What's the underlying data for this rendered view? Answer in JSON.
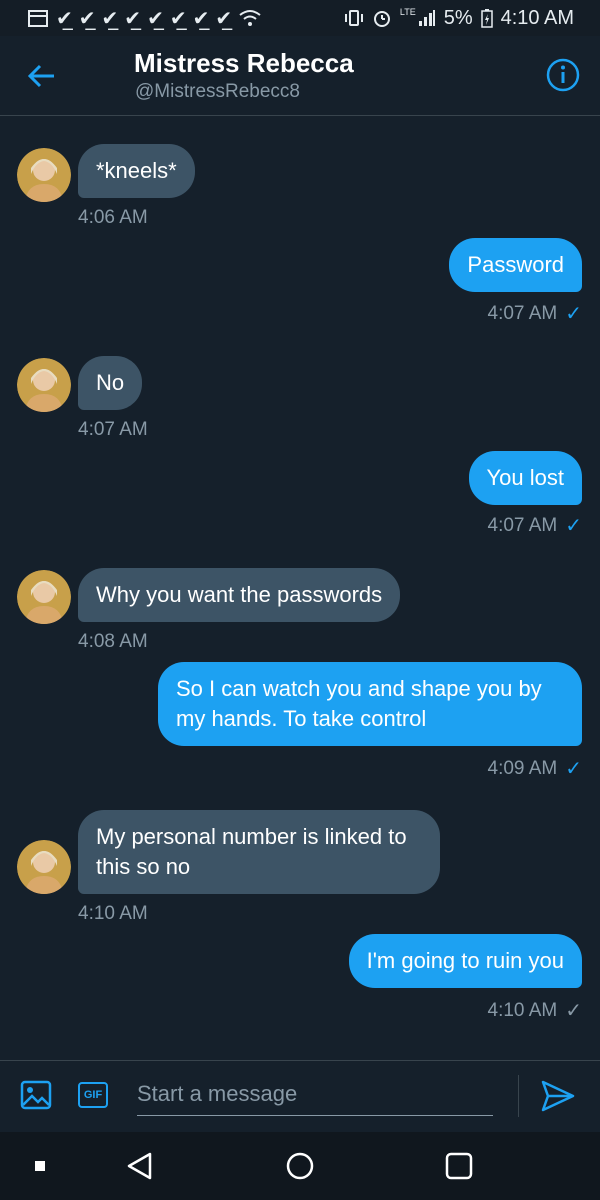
{
  "status": {
    "battery": "5%",
    "time": "4:10 AM",
    "network": "LTE"
  },
  "header": {
    "name": "Mistress Rebecca",
    "handle": "@MistressRebecc8"
  },
  "messages": [
    {
      "from": "them",
      "text": "*kneels*",
      "time": "4:06 AM"
    },
    {
      "from": "me",
      "text": "Password",
      "time": "4:07 AM",
      "status": "read"
    },
    {
      "from": "them",
      "text": "No",
      "time": "4:07 AM"
    },
    {
      "from": "me",
      "text": "You lost",
      "time": "4:07 AM",
      "status": "read"
    },
    {
      "from": "them",
      "text": "Why you want the passwords",
      "time": "4:08 AM"
    },
    {
      "from": "me",
      "text": "So I can watch you and shape you by my hands. To take control",
      "time": "4:09 AM",
      "status": "read"
    },
    {
      "from": "them",
      "text": "My personal number is linked to this so no",
      "time": "4:10 AM"
    },
    {
      "from": "me",
      "text": "I'm going to ruin you",
      "time": "4:10 AM",
      "status": "sent"
    }
  ],
  "composer": {
    "placeholder": "Start a message",
    "gif_label": "GIF"
  },
  "colors": {
    "background": "#15202b",
    "accent": "#1da1f2",
    "incoming_bubble": "#3d5466",
    "muted_text": "#8899a6"
  }
}
